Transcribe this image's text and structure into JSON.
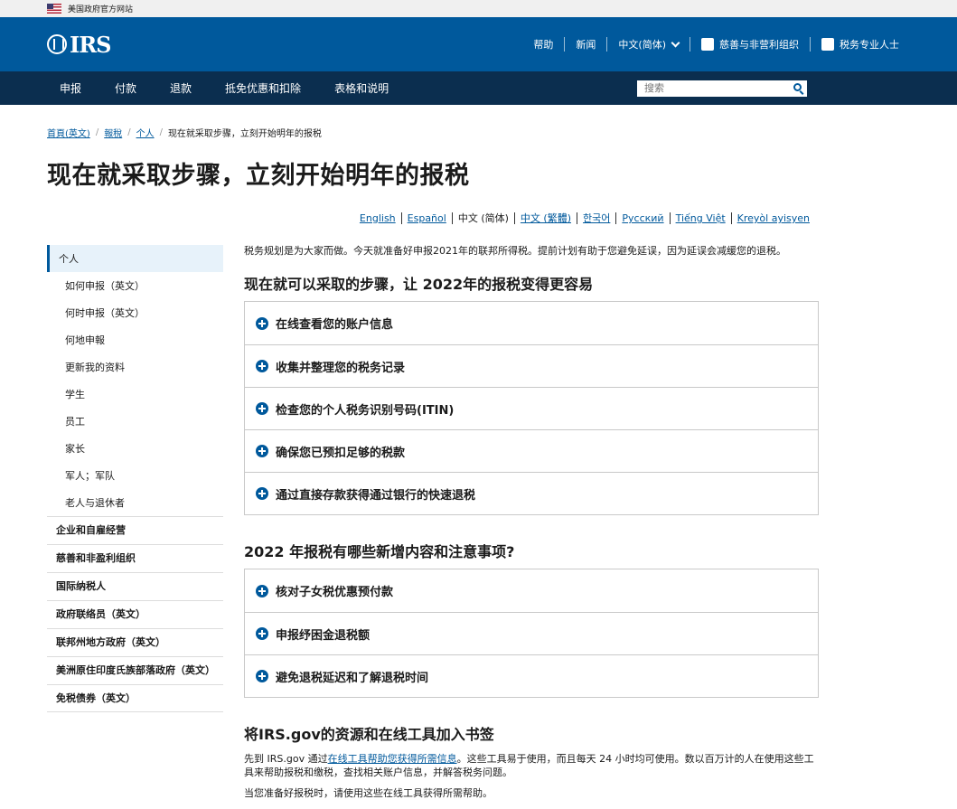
{
  "gov_banner": {
    "text": "美国政府官方网站"
  },
  "header": {
    "logo_text": "IRS",
    "top_nav": [
      "帮助",
      "新闻",
      "中文(简体)",
      "慈善与非营利组织",
      "税务专业人士"
    ]
  },
  "main_nav": {
    "items": [
      "申报",
      "付款",
      "退款",
      "抵免优惠和扣除",
      "表格和说明"
    ],
    "search_placeholder": "搜索"
  },
  "breadcrumb": {
    "links": [
      "首頁(英文)",
      "報稅",
      "个人"
    ],
    "current": "现在就采取步骤，立刻开始明年的报税"
  },
  "page_title": "现在就采取步骤，立刻开始明年的报税",
  "languages": {
    "links": [
      "English",
      "Español"
    ],
    "current": "中文 (简体)",
    "links2": [
      "中文 (繁體)",
      "한국어",
      "Русский",
      "Tiếng Việt",
      "Kreyòl ayisyen"
    ]
  },
  "sidebar": {
    "active": "个人",
    "sub_items": [
      "如何申报（英文）",
      "何时申报（英文）",
      "何地申報",
      "更新我的资料",
      "学生",
      "员工",
      "家长",
      "军人；军队",
      "老人与退休者"
    ],
    "main_items": [
      "企业和自雇经营",
      "慈善和非盈利组织",
      "国际纳税人",
      "政府联络员（英文）",
      "联邦州地方政府（英文）",
      "美洲原住印度氏族部落政府（英文）",
      "免税债券（英文）"
    ]
  },
  "content": {
    "intro": "税务规划是为大家而做。今天就准备好申报2021年的联邦所得税。提前计划有助于您避免延误，因为延误会减缓您的退税。",
    "section1_title": "现在就可以采取的步骤，让 2022年的报税变得更容易",
    "section1_items": [
      "在线查看您的账户信息",
      "收集并整理您的税务记录",
      "检查您的个人税务识别号码(ITIN)",
      "确保您已预扣足够的税款",
      "通过直接存款获得通过银行的快速退税"
    ],
    "section2_title": "2022 年报税有哪些新增内容和注意事项?",
    "section2_items": [
      "核对子女税优惠预付款",
      "申报纾困金退税额",
      "避免退税延迟和了解退税时间"
    ],
    "section3_title": "将IRS.gov的资源和在线工具加入书签",
    "para1_before": "先到 IRS.gov 通过",
    "para1_link": "在线工具帮助您获得所需信息",
    "para1_after": "。这些工具易于使用，而且每天 24 小时均可使用。数以百万计的人在使用这些工具来帮助报税和缴税，查找相关账户信息，并解答税务问题。",
    "para2": "当您准备好报税时，请使用这些在线工具获得所需帮助。"
  }
}
